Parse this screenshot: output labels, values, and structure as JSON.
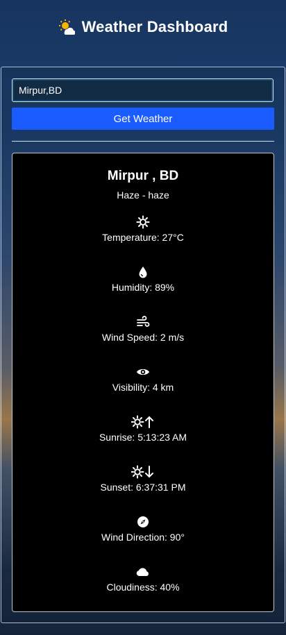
{
  "header": {
    "title": "Weather Dashboard",
    "icon": "sun-behind-cloud-icon"
  },
  "search": {
    "value": "Mirpur,BD",
    "placeholder": ""
  },
  "button": {
    "label": "Get Weather"
  },
  "colors": {
    "button": "#1a5cff",
    "card": "#000000",
    "text": "#ffffff"
  },
  "weather": {
    "city": "Mirpur , BD",
    "description": "Haze - haze",
    "items": [
      {
        "icon": "sun-gear-icon",
        "label": "Temperature: 27°C"
      },
      {
        "icon": "droplet-icon",
        "label": "Humidity: 89%"
      },
      {
        "icon": "wind-icon",
        "label": "Wind Speed: 2 m/s"
      },
      {
        "icon": "eye-icon",
        "label": "Visibility: 4 km"
      },
      {
        "icon": "sunrise-icon",
        "label": "Sunrise: 5:13:23 AM"
      },
      {
        "icon": "sunset-icon",
        "label": "Sunset: 6:37:31 PM"
      },
      {
        "icon": "compass-icon",
        "label": "Wind Direction: 90°"
      },
      {
        "icon": "cloud-icon",
        "label": "Cloudiness: 40%"
      }
    ]
  }
}
